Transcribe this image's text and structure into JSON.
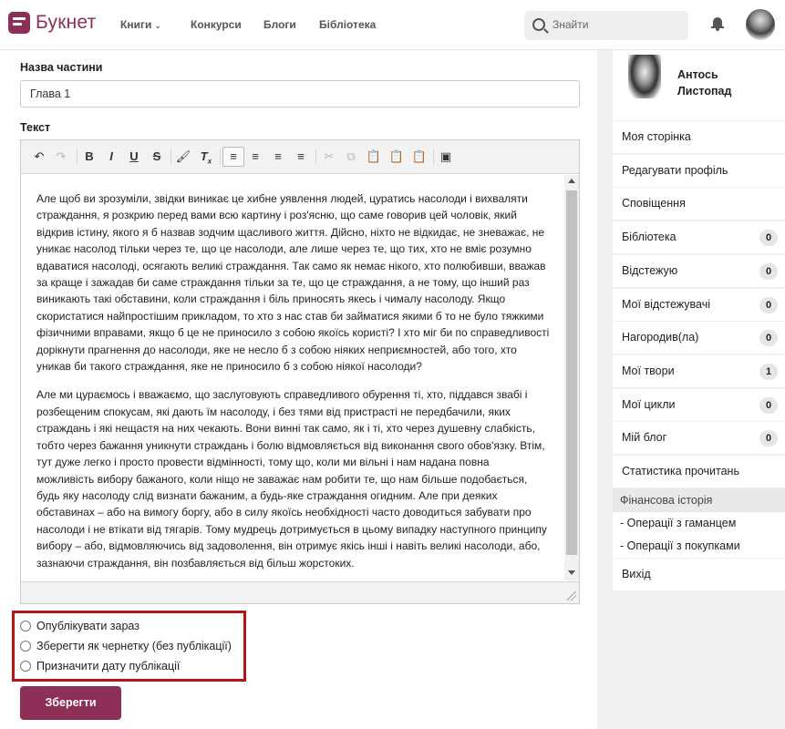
{
  "header": {
    "logo": "Букнет",
    "nav": [
      "Книги",
      "Конкурси",
      "Блоги",
      "Бібліотека"
    ],
    "search_placeholder": "Знайти"
  },
  "form": {
    "part_title_label": "Назва частини",
    "part_title_value": "Глава 1",
    "text_label": "Текст",
    "paragraphs": [
      "Але щоб ви зрозуміли, звідки виникає це хибне уявлення людей, цуратись насолоди і вихваляти страждання, я розкрию перед вами всю картину і роз'ясню, що саме говорив цей чоловік, який відкрив істину, якого я б назвав зодчим щасливого життя. Дійсно, ніхто не відкидає, не зневажає, не уникає насолод тільки через те, що це насолоди, але лише через те, що тих, хто не вміє розумно вдаватися насолоді, осягають великі страждання. Так само як немає нікого, хто полюбивши, вважав за краще і зажадав би саме страждання тільки за те, що це страждання, а не тому, що інший раз виникають такі обставини, коли страждання і біль приносять якесь і чималу насолоду. Якщо скористатися найпростішим прикладом, то хто з нас став би займатися якими б то не було тяжкими фізичними вправами, якщо б це не приносило з собою якоїсь користі? І хто міг би по справедливості дорікнути прагнення до насолоди, яке не несло б з собою ніяких неприємностей, або того, хто уникав би такого страждання, яке не приносило б з собою ніякої насолоди?",
      "Але ми цураємось і вважаємо, що  заслуговують справедливого обурення ті, хто, піддався звабі і розбещеним спокусам, які дають їм насолоду, і без тями від пристрасті не передбачили, яких страждань і які нещастя на них чекають. Вони винні так само, як і ті, хто через душевну слабкість, тобто через бажання уникнути страждань і болю відмовляється від виконання свого обов'язку. Втім, тут дуже легко і просто провести відмінності, тому що, коли ми вільні і нам надана повна можливість вибору бажаного, коли ніщо не заважає нам робити те, що нам більше подобається, будь яку насолоду слід визнати бажаним, а будь-яке страждання огидним. Але при деяких обставинах – або на вимогу боргу, або в силу якоїсь необхідності часто доводиться забувати про насолоди і не втікати від тягарів. Тому мудрець дотримується в цьому випадку наступного принципу вибору – або, відмовляючись від задоволення, він отримує якісь інші і навіть великі насолоди, або, зазнаючи страждання, він позбавляється від більш жорстоких."
    ],
    "publish_options": [
      "Опублікувати зараз",
      "Зберегти як чернетку (без публікації)",
      "Призначити дату публікації"
    ],
    "save_label": "Зберегти"
  },
  "sidebar": {
    "user_name": "Антось Листопад",
    "items": [
      {
        "label": "Моя сторінка"
      },
      {
        "label": "Редагувати профіль"
      },
      {
        "label": "Сповіщення"
      },
      {
        "label": "Бібліотека",
        "count": "0"
      },
      {
        "label": "Відстежую",
        "count": "0"
      },
      {
        "label": "Мої відстежувачі",
        "count": "0"
      },
      {
        "label": "Нагородив(ла)",
        "count": "0"
      },
      {
        "label": "Мої твори",
        "count": "1"
      },
      {
        "label": "Мої цикли",
        "count": "0"
      },
      {
        "label": "Мій блог",
        "count": "0"
      },
      {
        "label": "Статистика прочитань"
      }
    ],
    "finance_header": "Фінансова історія",
    "finance_items": [
      "- Операції з гаманцем",
      "- Операції з покупками"
    ],
    "logout": "Вихід"
  }
}
